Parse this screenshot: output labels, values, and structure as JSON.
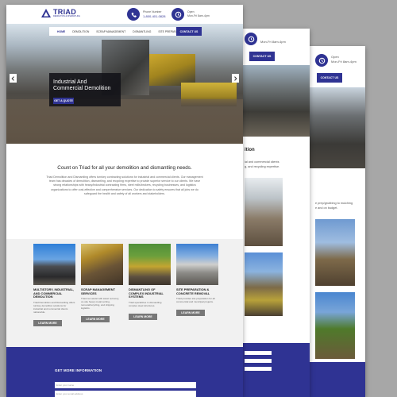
{
  "brand": {
    "name": "TRIAD",
    "tagline": "DEMOLITION & DISMANTLING"
  },
  "header": {
    "phone_label": "Phone Number",
    "phone_value": "1-800-401-0828",
    "hours_label": "Open",
    "hours_value": "Mon-Fri 8am-4pm",
    "contact_button": "CONTACT US"
  },
  "nav": {
    "items": [
      "HOME",
      "DEMOLITION",
      "SCRAP MANAGEMENT",
      "DISMANTLING",
      "SITE PREPARATION"
    ]
  },
  "hero": {
    "title_line1": "Industrial And",
    "title_line2": "Commercial Demolition",
    "cta": "GET A QUOTE"
  },
  "intro": {
    "heading": "Count on Triad for all your demolition and dismantling needs.",
    "body": "Triad Demolition and Dismantling offers turnkey contracting solutions for industrial and commercial clients. Our management team has decades of demolition, dismantling, and recycling expertise to provide superior service to our clients. We have strong relationships with heavy/industrial contracting firms, steel mills/brokers, recycling businesses, and logistics organizations to offer cost-effective and comprehensive services. Our dedication to safety ensures that all jobs we do safeguard the health and safety of all workers and stakeholders."
  },
  "services": [
    {
      "title": "MULTISTORY, INDUSTRIAL, AND COMMERCIAL DEMOLITION",
      "body": "Triad Demolition and Dismantling offers turnkey demolition solutions for industrial and commercial clients nationwide.",
      "button": "LEARN MORE"
    },
    {
      "title": "SCRAP MANAGEMENT SERVICES",
      "body": "Triad can assist with asset recovery, on-site heavy metal sorting, removal/recycling, and shipping logistics.",
      "button": "LEARN MORE"
    },
    {
      "title": "DISMANTLING OF COMPLEX INDUSTRIAL SYSTEMS",
      "body": "Triad specializes in dismantling complex steel structures.",
      "button": "LEARN MORE"
    },
    {
      "title": "SITE PREPARATION & CONCRETE REMOVAL",
      "body": "Triad provides site preparation for all commercial and municipal projects.",
      "button": "LEARN MORE"
    }
  ],
  "footer": {
    "heading": "GET MORE INFORMATION",
    "name_placeholder": "Enter your name",
    "email_placeholder": "Enter your email address"
  },
  "back_page_1": {
    "hours_value": "Mon-Fri 8am-4pm",
    "contact_button": "CONTACT US",
    "section_fragment": "ition",
    "text_line1": "ial and commercial clients",
    "text_line2": "g, and recycling expertise."
  },
  "back_page_2": {
    "hours_label": "Open",
    "hours_value": "Mon-Fri 8am-4pm",
    "contact_button": "CONTACT US",
    "text_line1": "e prep/grubbing to mulching",
    "text_line2": "e and on budget."
  }
}
